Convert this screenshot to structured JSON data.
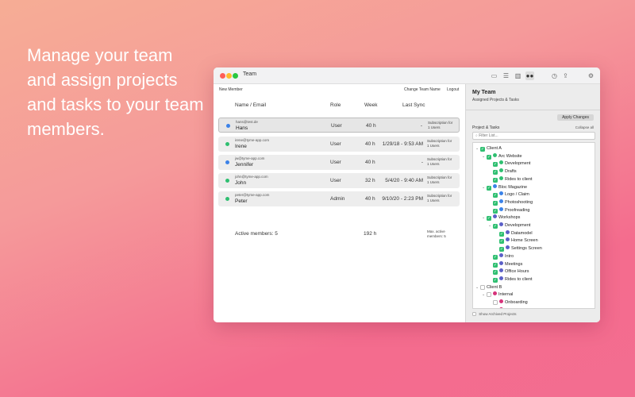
{
  "headline": [
    "Manage your team",
    "and assign projects",
    "and tasks to your team",
    "members."
  ],
  "window": {
    "title": "Team"
  },
  "toolbar": {
    "new_member": "New Member",
    "change_team_name": "Change Team Name",
    "logout": "Logout"
  },
  "columns": {
    "name": "Name / Email",
    "role": "Role",
    "week": "Week",
    "sync": "Last Sync"
  },
  "members": [
    {
      "email": "hans@test.de",
      "name": "Hans",
      "role": "User",
      "week": "40 h",
      "sync": "-",
      "sub1": "Subscription for",
      "sub2": "1 Users",
      "dot": "#3b82e8",
      "selected": true
    },
    {
      "email": "irene@tyme-app.com",
      "name": "Irene",
      "role": "User",
      "week": "40 h",
      "sync": "1/29/18 - 9:53 AM",
      "sub1": "Subscription for",
      "sub2": "1 Users",
      "dot": "#2fbf71",
      "selected": false
    },
    {
      "email": "jw@tyme-app.com",
      "name": "Jennifer",
      "role": "User",
      "week": "40 h",
      "sync": "-",
      "sub1": "Subscription for",
      "sub2": "1 Users",
      "dot": "#3b82e8",
      "selected": false
    },
    {
      "email": "john@tyme-app.com",
      "name": "John",
      "role": "User",
      "week": "32 h",
      "sync": "5/4/20 - 9:40 AM",
      "sub1": "Subscription for",
      "sub2": "1 Users",
      "dot": "#2fbf71",
      "selected": false
    },
    {
      "email": "peter@tyme-app.com",
      "name": "Peter",
      "role": "Admin",
      "week": "40 h",
      "sync": "9/10/20 - 2:23 PM",
      "sub1": "Subscription for",
      "sub2": "1 Users",
      "dot": "#2fbf71",
      "selected": false
    }
  ],
  "footer": {
    "active": "Active members: 5",
    "total_week": "192 h",
    "max1": "Max. active",
    "max2": "members: 5"
  },
  "panel": {
    "title": "My Team",
    "subtitle": "Assigned Projects & Tasks",
    "apply": "Apply Changes",
    "projects_label": "Project & Tasks",
    "collapse": "Collapse all",
    "filter_placeholder": "Filter List...",
    "show_archived": "Show Archived Projects"
  },
  "tree": [
    {
      "label": "Client A",
      "level": 0,
      "chev": "v",
      "checked": true,
      "dot": ""
    },
    {
      "label": "Arc Website",
      "level": 1,
      "chev": "v",
      "checked": true,
      "dot": "#2fbf71"
    },
    {
      "label": "Development",
      "level": 2,
      "chev": "",
      "checked": true,
      "dot": "#2fbf71"
    },
    {
      "label": "Drafts",
      "level": 2,
      "chev": "",
      "checked": true,
      "dot": "#2fbf71"
    },
    {
      "label": "Rides to client",
      "level": 2,
      "chev": "",
      "checked": true,
      "dot": "#2fbf71"
    },
    {
      "label": "Bloc Magazine",
      "level": 1,
      "chev": "v",
      "checked": true,
      "dot": "#3b82e8"
    },
    {
      "label": "Logo / Claim",
      "level": 2,
      "chev": "",
      "checked": true,
      "dot": "#3b82e8"
    },
    {
      "label": "Photoshooting",
      "level": 2,
      "chev": "",
      "checked": true,
      "dot": "#3b82e8"
    },
    {
      "label": "Proofreading",
      "level": 2,
      "chev": "",
      "checked": true,
      "dot": "#3b82e8"
    },
    {
      "label": "Workshops",
      "level": 1,
      "chev": "v",
      "checked": true,
      "dot": "#5b5fc7"
    },
    {
      "label": "Development",
      "level": 2,
      "chev": "v",
      "checked": true,
      "dot": "#5b5fc7"
    },
    {
      "label": "Datamodel",
      "level": 3,
      "chev": "",
      "checked": true,
      "dot": "#5b5fc7"
    },
    {
      "label": "Home Screen",
      "level": 3,
      "chev": "",
      "checked": true,
      "dot": "#5b5fc7"
    },
    {
      "label": "Settings Screen",
      "level": 3,
      "chev": "",
      "checked": true,
      "dot": "#5b5fc7"
    },
    {
      "label": "Intro",
      "level": 2,
      "chev": "",
      "checked": true,
      "dot": "#5b5fc7"
    },
    {
      "label": "Meetings",
      "level": 2,
      "chev": "",
      "checked": true,
      "dot": "#5b5fc7"
    },
    {
      "label": "Office Hours",
      "level": 2,
      "chev": "",
      "checked": true,
      "dot": "#5b5fc7"
    },
    {
      "label": "Rides to client",
      "level": 2,
      "chev": "",
      "checked": true,
      "dot": "#5b5fc7"
    },
    {
      "label": "Client B",
      "level": 0,
      "chev": "v",
      "checked": false,
      "dot": ""
    },
    {
      "label": "Internal",
      "level": 1,
      "chev": "v",
      "checked": false,
      "dot": "#d6337a"
    },
    {
      "label": "Onboarding",
      "level": 2,
      "chev": "",
      "checked": false,
      "dot": "#d6337a"
    },
    {
      "label": "Training",
      "level": 2,
      "chev": "",
      "checked": false,
      "dot": "#d6337a"
    }
  ]
}
